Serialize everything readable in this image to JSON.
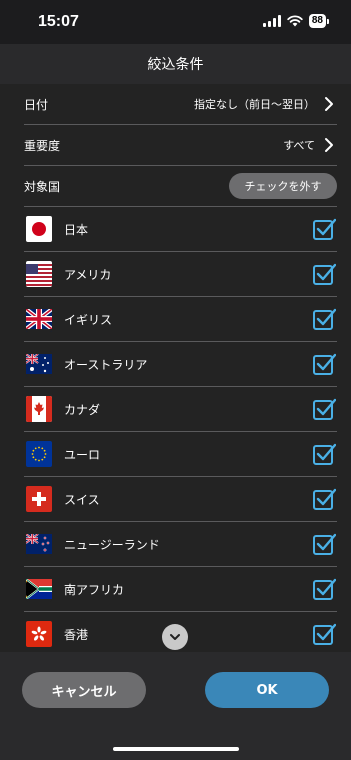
{
  "status_bar": {
    "time": "15:07",
    "battery": "88"
  },
  "header": {
    "title": "絞込条件"
  },
  "filters": {
    "date": {
      "label": "日付",
      "value": "指定なし（前日〜翌日）"
    },
    "importance": {
      "label": "重要度",
      "value": "すべて"
    },
    "country": {
      "label": "対象国",
      "uncheck_label": "チェックを外す"
    }
  },
  "countries": [
    {
      "name": "日本",
      "flag": "japan-flag-icon",
      "checked": true
    },
    {
      "name": "アメリカ",
      "flag": "usa-flag-icon",
      "checked": true
    },
    {
      "name": "イギリス",
      "flag": "uk-flag-icon",
      "checked": true
    },
    {
      "name": "オーストラリア",
      "flag": "australia-flag-icon",
      "checked": true
    },
    {
      "name": "カナダ",
      "flag": "canada-flag-icon",
      "checked": true
    },
    {
      "name": "ユーロ",
      "flag": "eu-flag-icon",
      "checked": true
    },
    {
      "name": "スイス",
      "flag": "switzerland-flag-icon",
      "checked": true
    },
    {
      "name": "ニュージーランド",
      "flag": "new-zealand-flag-icon",
      "checked": true
    },
    {
      "name": "南アフリカ",
      "flag": "south-africa-flag-icon",
      "checked": true
    },
    {
      "name": "香港",
      "flag": "hong-kong-flag-icon",
      "checked": true
    }
  ],
  "footer": {
    "cancel_label": "キャンセル",
    "ok_label": "OK"
  },
  "colors": {
    "accent": "#3a87b8",
    "checkbox": "#4ab0e6",
    "background": "#232323"
  }
}
